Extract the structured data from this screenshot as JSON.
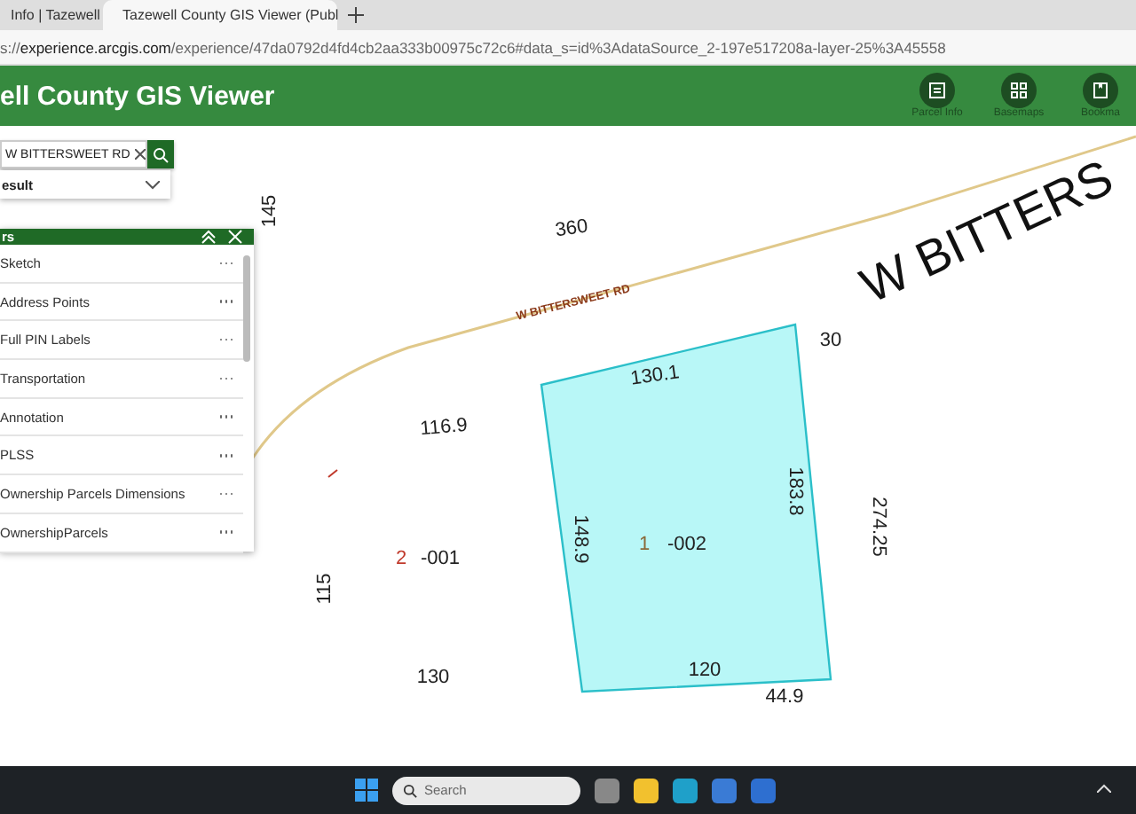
{
  "browser": {
    "tabs": [
      {
        "title": "Info | Tazewell",
        "selected": false
      },
      {
        "title": "Tazewell County GIS Viewer (Publ",
        "selected": true
      }
    ],
    "url": {
      "scheme": "s://",
      "host": "experience.arcgis.com",
      "path": "/experience/47da0792d4fd4cb2aa333b00975c72c6#data_s=id%3AdataSource_2-197e517208a-layer-25%3A45558"
    }
  },
  "header": {
    "title": "ell County GIS Viewer",
    "tools": [
      {
        "label": "Parcel Info",
        "kind": "parcel"
      },
      {
        "label": "Basemaps",
        "kind": "basemaps"
      },
      {
        "label": "Bookma",
        "kind": "bookmark"
      }
    ]
  },
  "search": {
    "value": "W BITTERSWEET RD",
    "result_label": "esult"
  },
  "layers_panel": {
    "title": "rs",
    "items": [
      {
        "name": "Sketch"
      },
      {
        "name": "Address Points"
      },
      {
        "name": "Full PIN Labels"
      },
      {
        "name": "Transportation"
      },
      {
        "name": "Annotation"
      },
      {
        "name": "PLSS"
      },
      {
        "name": "Ownership Parcels Dimensions"
      },
      {
        "name": "OwnershipParcels"
      }
    ]
  },
  "map": {
    "labels": [
      {
        "text": "145",
        "kind": "dimension"
      },
      {
        "text": "360",
        "kind": "dimension"
      },
      {
        "text": "W BITTERSWEET RD",
        "kind": "road"
      },
      {
        "text": "W BITTERS",
        "kind": "road-large"
      },
      {
        "text": "30",
        "kind": "dimension"
      },
      {
        "text": "130.1",
        "kind": "dimension"
      },
      {
        "text": "116.9",
        "kind": "dimension"
      },
      {
        "text": "183.8",
        "kind": "dimension"
      },
      {
        "text": "274.25",
        "kind": "dimension"
      },
      {
        "text": "148.9",
        "kind": "dimension"
      },
      {
        "text": "1",
        "kind": "parcel-number",
        "color": "#8a6a3a"
      },
      {
        "text": "-002",
        "kind": "parcel-id"
      },
      {
        "text": "2",
        "kind": "parcel-number",
        "color": "#c0392b"
      },
      {
        "text": "-001",
        "kind": "parcel-id"
      },
      {
        "text": "115",
        "kind": "dimension"
      },
      {
        "text": "130",
        "kind": "dimension"
      },
      {
        "text": "120",
        "kind": "dimension"
      },
      {
        "text": "44.9",
        "kind": "dimension"
      }
    ]
  },
  "taskbar": {
    "search_placeholder": "Search"
  }
}
